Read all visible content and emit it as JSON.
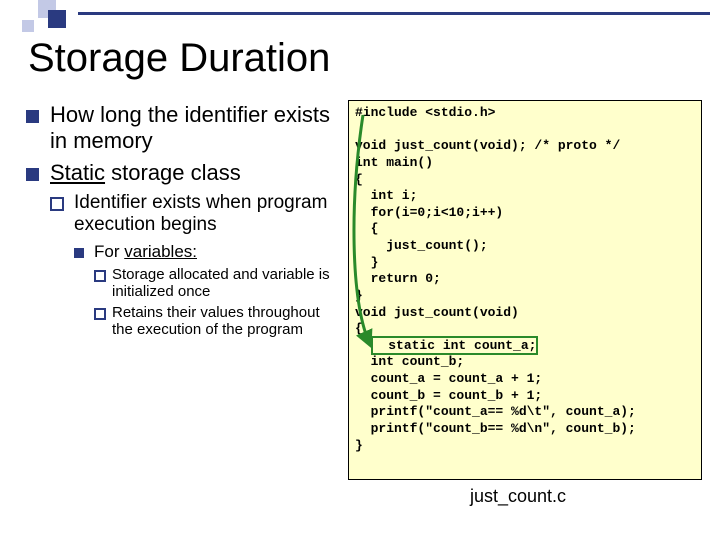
{
  "title": "Storage Duration",
  "bullets": {
    "b1a": "How long the identifier exists in memory",
    "b1b_pre": "Static",
    "b1b_post": " storage class",
    "b2": "Identifier exists when program execution begins",
    "b3_pre": "For ",
    "b3_u": "variables:",
    "b4a": "Storage allocated and variable is initialized once",
    "b4b": "Retains their values throughout the execution of the program"
  },
  "code": {
    "l01": "#include <stdio.h>",
    "l02": "",
    "l03": "void just_count(void); /* proto */",
    "l04": "int main()",
    "l05": "{",
    "l06": "  int i;",
    "l07": "  for(i=0;i<10;i++)",
    "l08": "  {",
    "l09": "    just_count();",
    "l10": "  }",
    "l11": "  return 0;",
    "l12": "}",
    "l13": "void just_count(void)",
    "l14": "{",
    "l15": "  static int count_a;",
    "l16": "  int count_b;",
    "l17": "  count_a = count_a + 1;",
    "l18": "  count_b = count_b + 1;",
    "l19": "  printf(\"count_a== %d\\t\", count_a);",
    "l20": "  printf(\"count_b== %d\\n\", count_b);",
    "l21": "}"
  },
  "caption": "just_count.c"
}
